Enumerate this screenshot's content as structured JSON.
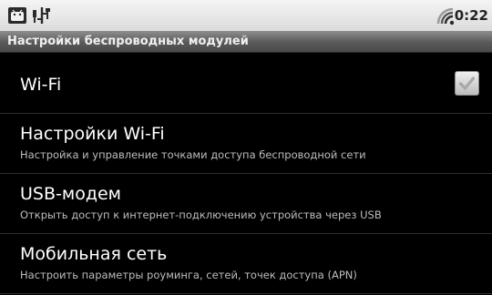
{
  "status_bar": {
    "time": "0:22",
    "icons": [
      "android-notification-icon",
      "usb-icon",
      "wifi-signal-icon"
    ]
  },
  "title_bar": {
    "title": "Настройки беспроводных модулей"
  },
  "settings": {
    "items": [
      {
        "title": "Wi-Fi",
        "checked": true
      },
      {
        "title": "Настройки Wi-Fi",
        "subtitle": "Настройка и управление точками доступа беспроводной сети"
      },
      {
        "title": "USB-модем",
        "subtitle": "Открыть доступ к интернет-подключению устройства через USB"
      },
      {
        "title": "Мобильная сеть",
        "subtitle": "Настроить параметры роуминга, сетей, точек доступа (APN)"
      }
    ]
  },
  "colors": {
    "background": "#000000",
    "status_bar": "#e6e6e6",
    "title_bar": "#5a5a5a",
    "text_primary": "#ffffff",
    "text_secondary": "#bdbdbd"
  }
}
